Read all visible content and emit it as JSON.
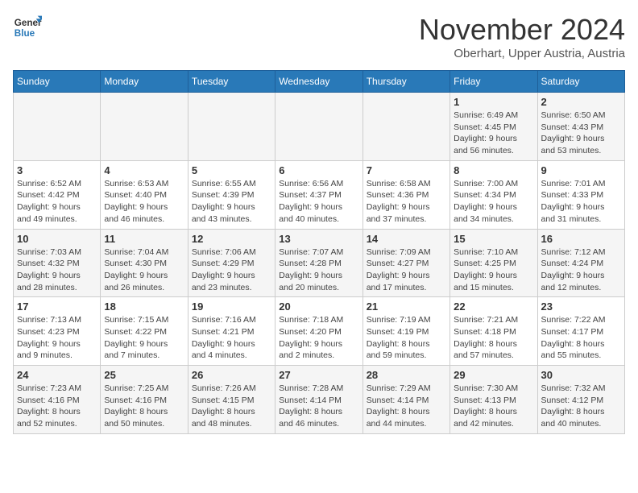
{
  "logo": {
    "text_general": "General",
    "text_blue": "Blue"
  },
  "header": {
    "month": "November 2024",
    "location": "Oberhart, Upper Austria, Austria"
  },
  "weekdays": [
    "Sunday",
    "Monday",
    "Tuesday",
    "Wednesday",
    "Thursday",
    "Friday",
    "Saturday"
  ],
  "weeks": [
    [
      {
        "day": "",
        "info": ""
      },
      {
        "day": "",
        "info": ""
      },
      {
        "day": "",
        "info": ""
      },
      {
        "day": "",
        "info": ""
      },
      {
        "day": "",
        "info": ""
      },
      {
        "day": "1",
        "info": "Sunrise: 6:49 AM\nSunset: 4:45 PM\nDaylight: 9 hours\nand 56 minutes."
      },
      {
        "day": "2",
        "info": "Sunrise: 6:50 AM\nSunset: 4:43 PM\nDaylight: 9 hours\nand 53 minutes."
      }
    ],
    [
      {
        "day": "3",
        "info": "Sunrise: 6:52 AM\nSunset: 4:42 PM\nDaylight: 9 hours\nand 49 minutes."
      },
      {
        "day": "4",
        "info": "Sunrise: 6:53 AM\nSunset: 4:40 PM\nDaylight: 9 hours\nand 46 minutes."
      },
      {
        "day": "5",
        "info": "Sunrise: 6:55 AM\nSunset: 4:39 PM\nDaylight: 9 hours\nand 43 minutes."
      },
      {
        "day": "6",
        "info": "Sunrise: 6:56 AM\nSunset: 4:37 PM\nDaylight: 9 hours\nand 40 minutes."
      },
      {
        "day": "7",
        "info": "Sunrise: 6:58 AM\nSunset: 4:36 PM\nDaylight: 9 hours\nand 37 minutes."
      },
      {
        "day": "8",
        "info": "Sunrise: 7:00 AM\nSunset: 4:34 PM\nDaylight: 9 hours\nand 34 minutes."
      },
      {
        "day": "9",
        "info": "Sunrise: 7:01 AM\nSunset: 4:33 PM\nDaylight: 9 hours\nand 31 minutes."
      }
    ],
    [
      {
        "day": "10",
        "info": "Sunrise: 7:03 AM\nSunset: 4:32 PM\nDaylight: 9 hours\nand 28 minutes."
      },
      {
        "day": "11",
        "info": "Sunrise: 7:04 AM\nSunset: 4:30 PM\nDaylight: 9 hours\nand 26 minutes."
      },
      {
        "day": "12",
        "info": "Sunrise: 7:06 AM\nSunset: 4:29 PM\nDaylight: 9 hours\nand 23 minutes."
      },
      {
        "day": "13",
        "info": "Sunrise: 7:07 AM\nSunset: 4:28 PM\nDaylight: 9 hours\nand 20 minutes."
      },
      {
        "day": "14",
        "info": "Sunrise: 7:09 AM\nSunset: 4:27 PM\nDaylight: 9 hours\nand 17 minutes."
      },
      {
        "day": "15",
        "info": "Sunrise: 7:10 AM\nSunset: 4:25 PM\nDaylight: 9 hours\nand 15 minutes."
      },
      {
        "day": "16",
        "info": "Sunrise: 7:12 AM\nSunset: 4:24 PM\nDaylight: 9 hours\nand 12 minutes."
      }
    ],
    [
      {
        "day": "17",
        "info": "Sunrise: 7:13 AM\nSunset: 4:23 PM\nDaylight: 9 hours\nand 9 minutes."
      },
      {
        "day": "18",
        "info": "Sunrise: 7:15 AM\nSunset: 4:22 PM\nDaylight: 9 hours\nand 7 minutes."
      },
      {
        "day": "19",
        "info": "Sunrise: 7:16 AM\nSunset: 4:21 PM\nDaylight: 9 hours\nand 4 minutes."
      },
      {
        "day": "20",
        "info": "Sunrise: 7:18 AM\nSunset: 4:20 PM\nDaylight: 9 hours\nand 2 minutes."
      },
      {
        "day": "21",
        "info": "Sunrise: 7:19 AM\nSunset: 4:19 PM\nDaylight: 8 hours\nand 59 minutes."
      },
      {
        "day": "22",
        "info": "Sunrise: 7:21 AM\nSunset: 4:18 PM\nDaylight: 8 hours\nand 57 minutes."
      },
      {
        "day": "23",
        "info": "Sunrise: 7:22 AM\nSunset: 4:17 PM\nDaylight: 8 hours\nand 55 minutes."
      }
    ],
    [
      {
        "day": "24",
        "info": "Sunrise: 7:23 AM\nSunset: 4:16 PM\nDaylight: 8 hours\nand 52 minutes."
      },
      {
        "day": "25",
        "info": "Sunrise: 7:25 AM\nSunset: 4:16 PM\nDaylight: 8 hours\nand 50 minutes."
      },
      {
        "day": "26",
        "info": "Sunrise: 7:26 AM\nSunset: 4:15 PM\nDaylight: 8 hours\nand 48 minutes."
      },
      {
        "day": "27",
        "info": "Sunrise: 7:28 AM\nSunset: 4:14 PM\nDaylight: 8 hours\nand 46 minutes."
      },
      {
        "day": "28",
        "info": "Sunrise: 7:29 AM\nSunset: 4:14 PM\nDaylight: 8 hours\nand 44 minutes."
      },
      {
        "day": "29",
        "info": "Sunrise: 7:30 AM\nSunset: 4:13 PM\nDaylight: 8 hours\nand 42 minutes."
      },
      {
        "day": "30",
        "info": "Sunrise: 7:32 AM\nSunset: 4:12 PM\nDaylight: 8 hours\nand 40 minutes."
      }
    ]
  ]
}
